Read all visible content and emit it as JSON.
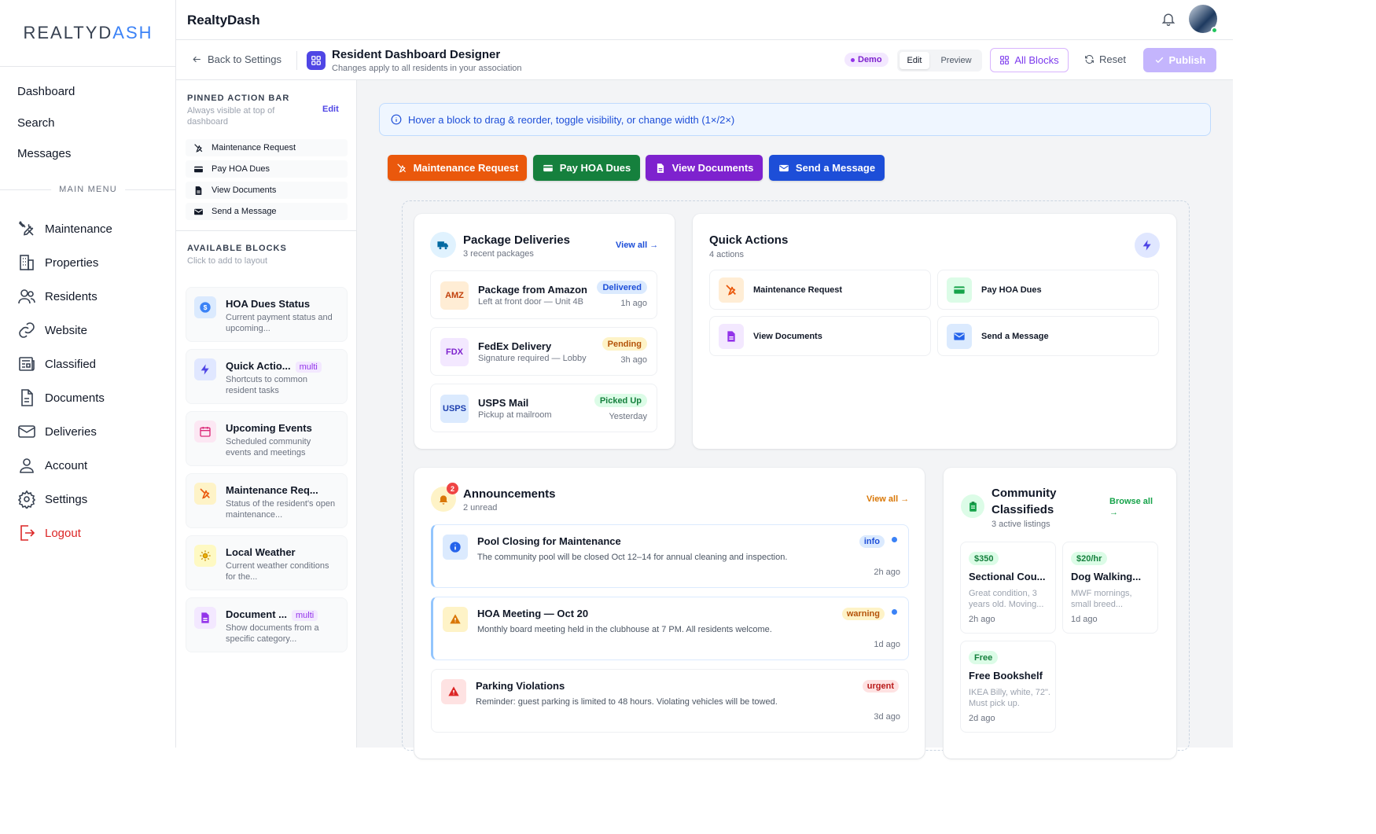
{
  "brand": {
    "logo_main": "REALTYD",
    "logo_accent": "ASH",
    "app_title": "RealtyDash"
  },
  "nav": {
    "top": [
      "Dashboard",
      "Search",
      "Messages"
    ],
    "section_label": "MAIN MENU",
    "items": [
      {
        "label": "Maintenance",
        "icon": "tools-icon"
      },
      {
        "label": "Properties",
        "icon": "building-icon"
      },
      {
        "label": "Residents",
        "icon": "users-icon"
      },
      {
        "label": "Website",
        "icon": "link-icon"
      },
      {
        "label": "Classified",
        "icon": "newspaper-icon"
      },
      {
        "label": "Documents",
        "icon": "document-icon"
      },
      {
        "label": "Deliveries",
        "icon": "mail-icon"
      },
      {
        "label": "Account",
        "icon": "user-icon"
      },
      {
        "label": "Settings",
        "icon": "gear-icon"
      },
      {
        "label": "Logout",
        "icon": "logout-icon"
      }
    ]
  },
  "subheader": {
    "back": "Back to Settings",
    "title": "Resident Dashboard Designer",
    "subtitle": "Changes apply to all residents in your association",
    "demo": "Demo",
    "edit": "Edit",
    "preview": "Preview",
    "all_blocks": "All Blocks",
    "reset": "Reset",
    "publish": "Publish"
  },
  "panel": {
    "pinned_title": "PINNED ACTION BAR",
    "pinned_sub": "Always visible at top of dashboard",
    "pinned_edit": "Edit",
    "pinned": [
      "Maintenance Request",
      "Pay HOA Dues",
      "View Documents",
      "Send a Message"
    ],
    "available_title": "AVAILABLE BLOCKS",
    "available_sub": "Click to add to layout",
    "multi": "multi",
    "blocks": [
      {
        "title": "HOA Dues Status",
        "desc": "Current payment status and upcoming..."
      },
      {
        "title": "Quick Actio...",
        "desc": "Shortcuts to common resident tasks"
      },
      {
        "title": "Upcoming Events",
        "desc": "Scheduled community events and meetings"
      },
      {
        "title": "Maintenance Req...",
        "desc": "Status of the resident's open maintenance..."
      },
      {
        "title": "Local Weather",
        "desc": "Current weather conditions for the..."
      },
      {
        "title": "Document ...",
        "desc": "Show documents from a specific category..."
      }
    ]
  },
  "canvas": {
    "hint": "Hover a block to drag & reorder, toggle visibility, or change width (1×/2×)",
    "actions": [
      {
        "label": "Maintenance Request",
        "color": "#ea580c"
      },
      {
        "label": "Pay HOA Dues",
        "color": "#15803d"
      },
      {
        "label": "View Documents",
        "color": "#7e22ce"
      },
      {
        "label": "Send a Message",
        "color": "#1d4ed8"
      }
    ],
    "packages": {
      "title": "Package Deliveries",
      "sub": "3 recent packages",
      "view_all": "View all →",
      "items": [
        {
          "logo": "AMZ",
          "name": "Package from Amazon",
          "detail": "Left at front door — Unit 4B",
          "status": "Delivered",
          "time": "1h ago"
        },
        {
          "logo": "FDX",
          "name": "FedEx Delivery",
          "detail": "Signature required — Lobby",
          "status": "Pending",
          "time": "3h ago"
        },
        {
          "logo": "USPS",
          "name": "USPS Mail",
          "detail": "Pickup at mailroom",
          "status": "Picked Up",
          "time": "Yesterday"
        }
      ]
    },
    "quick": {
      "title": "Quick Actions",
      "sub": "4 actions",
      "items": [
        "Maintenance Request",
        "Pay HOA Dues",
        "View Documents",
        "Send a Message"
      ]
    },
    "announcements": {
      "title": "Announcements",
      "sub": "2 unread",
      "badge": "2",
      "view_all": "View all →",
      "items": [
        {
          "title": "Pool Closing for Maintenance",
          "desc": "The community pool will be closed Oct 12–14 for annual cleaning and inspection.",
          "tag": "info",
          "time": "2h ago"
        },
        {
          "title": "HOA Meeting — Oct 20",
          "desc": "Monthly board meeting held in the clubhouse at 7 PM. All residents welcome.",
          "tag": "warning",
          "time": "1d ago"
        },
        {
          "title": "Parking Violations",
          "desc": "Reminder: guest parking is limited to 48 hours. Violating vehicles will be towed.",
          "tag": "urgent",
          "time": "3d ago"
        }
      ]
    },
    "classifieds": {
      "title_1": "Community",
      "title_2": "Classifieds",
      "sub": "3 active listings",
      "browse_1": "Browse all",
      "browse_2": "→",
      "items": [
        {
          "price": "$350",
          "title": "Sectional Cou...",
          "desc": "Great condition, 3 years old. Moving...",
          "time": "2h ago"
        },
        {
          "price": "$20/hr",
          "title": "Dog Walking...",
          "desc": "MWF mornings, small breed...",
          "time": "1d ago"
        },
        {
          "price": "Free",
          "title": "Free Bookshelf",
          "desc": "IKEA Billy, white, 72\". Must pick up.",
          "time": "2d ago"
        }
      ]
    }
  }
}
